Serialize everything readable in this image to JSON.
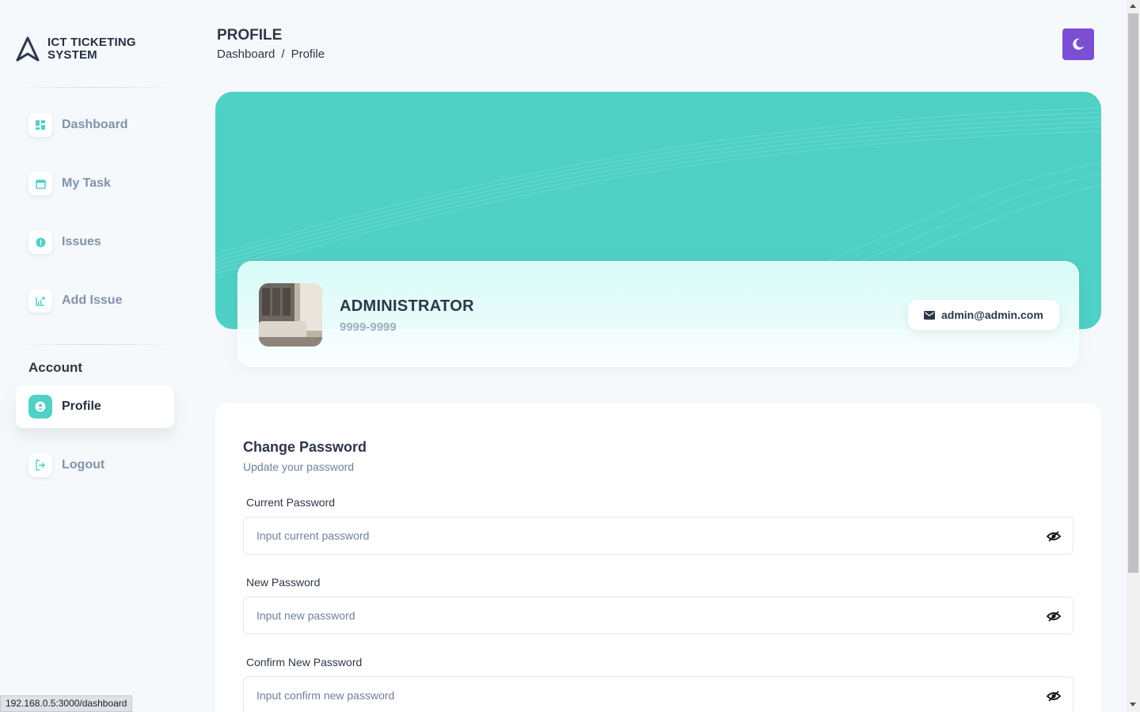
{
  "brand": {
    "name": "ICT TICKETING SYSTEM"
  },
  "sidebar": {
    "items": [
      {
        "label": "Dashboard",
        "icon": "dashboard-icon"
      },
      {
        "label": "My Task",
        "icon": "calendar-icon"
      },
      {
        "label": "Issues",
        "icon": "alert-icon"
      },
      {
        "label": "Add Issue",
        "icon": "add-chart-icon"
      }
    ],
    "section_title": "Account",
    "account_items": [
      {
        "label": "Profile",
        "icon": "user-icon",
        "active": true
      },
      {
        "label": "Logout",
        "icon": "logout-icon"
      }
    ]
  },
  "header": {
    "title": "PROFILE",
    "breadcrumb": [
      "Dashboard",
      "/",
      "Profile"
    ],
    "theme_toggle_icon": "moon-icon"
  },
  "profile": {
    "name": "ADMINISTRATOR",
    "phone": "9999-9999",
    "email": "admin@admin.com"
  },
  "password_form": {
    "title": "Change Password",
    "subtitle": "Update your password",
    "fields": [
      {
        "label": "Current Password",
        "placeholder": "Input current password",
        "value": ""
      },
      {
        "label": "New Password",
        "placeholder": "Input new password",
        "value": ""
      },
      {
        "label": "Confirm New Password",
        "placeholder": "Input confirm new password",
        "value": ""
      }
    ]
  },
  "status_bar": {
    "url": "192.168.0.5:3000/dashboard"
  },
  "colors": {
    "accent": "#4fd1c5",
    "theme_button": "#7b4fd4",
    "text_dark": "#2d3748",
    "text_muted": "#a0aec0"
  }
}
